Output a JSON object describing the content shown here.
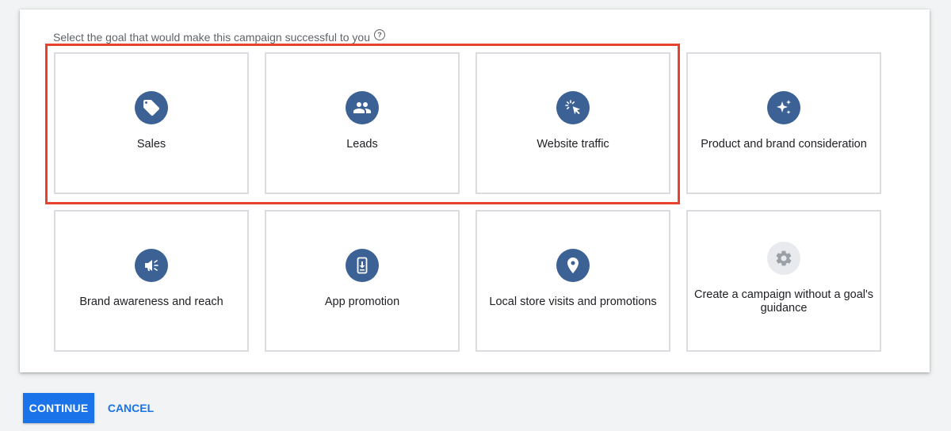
{
  "prompt": {
    "text": "Select the goal that would make this campaign successful to you",
    "help_glyph": "?"
  },
  "goals": [
    {
      "label": "Sales",
      "icon": "tag-icon"
    },
    {
      "label": "Leads",
      "icon": "people-icon"
    },
    {
      "label": "Website traffic",
      "icon": "cursor-click-icon"
    },
    {
      "label": "Product and brand consideration",
      "icon": "sparkle-icon"
    },
    {
      "label": "Brand awareness and reach",
      "icon": "megaphone-icon"
    },
    {
      "label": "App promotion",
      "icon": "phone-download-icon"
    },
    {
      "label": "Local store visits and promotions",
      "icon": "location-pin-icon"
    },
    {
      "label": "Create a campaign without a goal's guidance",
      "icon": "gear-icon"
    }
  ],
  "actions": {
    "continue_label": "CONTINUE",
    "cancel_label": "CANCEL"
  },
  "colors": {
    "accent": "#1a73e8",
    "icon_circle": "#3c6195",
    "highlight_border": "#e8412d"
  }
}
